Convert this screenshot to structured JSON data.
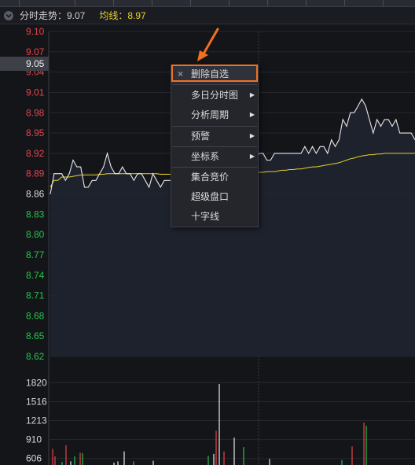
{
  "header": {
    "title": "分时走势：9.07",
    "avg_line": "均线：8.97"
  },
  "price_axis": {
    "ticks": [
      {
        "label": "9.10",
        "color": "#e8434a"
      },
      {
        "label": "9.07",
        "color": "#e8434a"
      },
      {
        "label": "9.04",
        "color": "#e8434a"
      },
      {
        "label": "9.01",
        "color": "#e8434a"
      },
      {
        "label": "8.98",
        "color": "#e8434a"
      },
      {
        "label": "8.95",
        "color": "#e8434a"
      },
      {
        "label": "8.92",
        "color": "#e8434a"
      },
      {
        "label": "8.89",
        "color": "#e8434a"
      },
      {
        "label": "8.86",
        "color": "#d8d8d8"
      },
      {
        "label": "8.83",
        "color": "#27c24c"
      },
      {
        "label": "8.80",
        "color": "#27c24c"
      },
      {
        "label": "8.77",
        "color": "#27c24c"
      },
      {
        "label": "8.74",
        "color": "#27c24c"
      },
      {
        "label": "8.71",
        "color": "#27c24c"
      },
      {
        "label": "8.68",
        "color": "#27c24c"
      },
      {
        "label": "8.65",
        "color": "#27c24c"
      },
      {
        "label": "8.62",
        "color": "#27c24c"
      }
    ],
    "cursor_price": "9.05"
  },
  "volume_axis": {
    "ticks": [
      "1820",
      "1516",
      "1213",
      "910",
      "606"
    ]
  },
  "context_menu": {
    "items": [
      {
        "label": "删除自选",
        "submenu": false,
        "highlight": true
      },
      {
        "label": "多日分时图",
        "submenu": true
      },
      {
        "label": "分析周期",
        "submenu": true
      },
      {
        "label": "预警",
        "submenu": true
      },
      {
        "label": "坐标系",
        "submenu": true
      },
      {
        "label": "集合竞价",
        "submenu": false
      },
      {
        "label": "超级盘口",
        "submenu": false
      },
      {
        "label": "十字线",
        "submenu": false
      }
    ]
  },
  "chart_data": {
    "type": "line",
    "price_series": [
      8.86,
      8.89,
      8.89,
      8.89,
      8.88,
      8.89,
      8.91,
      8.9,
      8.9,
      8.87,
      8.87,
      8.88,
      8.88,
      8.89,
      8.9,
      8.92,
      8.9,
      8.89,
      8.89,
      8.9,
      8.89,
      8.89,
      8.88,
      8.89,
      8.89,
      8.88,
      8.87,
      8.89,
      8.88,
      8.87,
      8.88,
      8.88,
      8.88,
      8.88,
      8.88,
      8.88,
      8.88,
      8.88,
      8.88,
      8.88,
      8.88,
      8.88,
      8.88,
      8.88,
      8.88,
      8.88,
      8.88,
      8.88,
      8.88,
      8.88,
      8.88,
      8.88,
      8.88,
      8.88,
      8.91,
      8.92,
      8.92,
      8.91,
      8.91,
      8.92,
      8.92,
      8.92,
      8.92,
      8.92,
      8.92,
      8.92,
      8.92,
      8.93,
      8.92,
      8.93,
      8.92,
      8.93,
      8.93,
      8.92,
      8.94,
      8.93,
      8.94,
      8.97,
      8.96,
      8.98,
      8.98,
      8.99,
      9.0,
      8.99,
      8.97,
      8.95,
      8.97,
      8.96,
      8.97,
      8.97,
      8.96,
      8.97,
      8.95,
      8.95,
      8.95,
      8.95,
      8.94
    ],
    "avg_series": [
      8.87,
      8.88,
      8.88,
      8.885,
      8.885,
      8.885,
      8.886,
      8.887,
      8.888,
      8.888,
      8.888,
      8.888,
      8.888,
      8.889,
      8.889,
      8.89,
      8.89,
      8.89,
      8.89,
      8.89,
      8.89,
      8.89,
      8.89,
      8.89,
      8.89,
      8.89,
      8.89,
      8.89,
      8.89,
      8.889,
      8.889,
      8.889,
      8.889,
      8.889,
      8.889,
      8.889,
      8.889,
      8.889,
      8.889,
      8.889,
      8.89,
      8.89,
      8.89,
      8.89,
      8.89,
      8.89,
      8.89,
      8.89,
      8.89,
      8.89,
      8.89,
      8.89,
      8.89,
      8.89,
      8.891,
      8.892,
      8.892,
      8.893,
      8.893,
      8.893,
      8.894,
      8.895,
      8.895,
      8.896,
      8.896,
      8.897,
      8.897,
      8.898,
      8.899,
      8.9,
      8.9,
      8.901,
      8.902,
      8.903,
      8.904,
      8.905,
      8.906,
      8.908,
      8.91,
      8.912,
      8.913,
      8.915,
      8.916,
      8.917,
      8.918,
      8.918,
      8.919,
      8.919,
      8.92,
      8.92,
      8.92,
      8.92,
      8.92,
      8.92,
      8.92,
      8.92,
      8.92
    ],
    "ylim": [
      8.62,
      9.1
    ],
    "volume": [
      {
        "v": 760,
        "c": "red"
      },
      {
        "v": 640,
        "c": "red"
      },
      {
        "v": 550,
        "c": "green"
      },
      {
        "v": 820,
        "c": "red"
      },
      {
        "v": 560,
        "c": "white"
      },
      {
        "v": 640,
        "c": "green"
      },
      {
        "v": 700,
        "c": "red"
      },
      {
        "v": 690,
        "c": "green"
      },
      {
        "v": 540,
        "c": "white"
      },
      {
        "v": 560,
        "c": "white"
      },
      {
        "v": 720,
        "c": "white"
      },
      {
        "v": 560,
        "c": "green"
      },
      {
        "v": 570,
        "c": "white"
      },
      {
        "v": 650,
        "c": "green"
      },
      {
        "v": 680,
        "c": "white"
      },
      {
        "v": 1050,
        "c": "red"
      },
      {
        "v": 1800,
        "c": "white"
      },
      {
        "v": 720,
        "c": "red"
      },
      {
        "v": 940,
        "c": "white"
      },
      {
        "v": 790,
        "c": "green"
      },
      {
        "v": 600,
        "c": "white"
      },
      {
        "v": 580,
        "c": "green"
      },
      {
        "v": 800,
        "c": "red"
      },
      {
        "v": 1180,
        "c": "red"
      },
      {
        "v": 1130,
        "c": "green"
      }
    ],
    "vol_ylim": [
      500,
      1900
    ]
  }
}
